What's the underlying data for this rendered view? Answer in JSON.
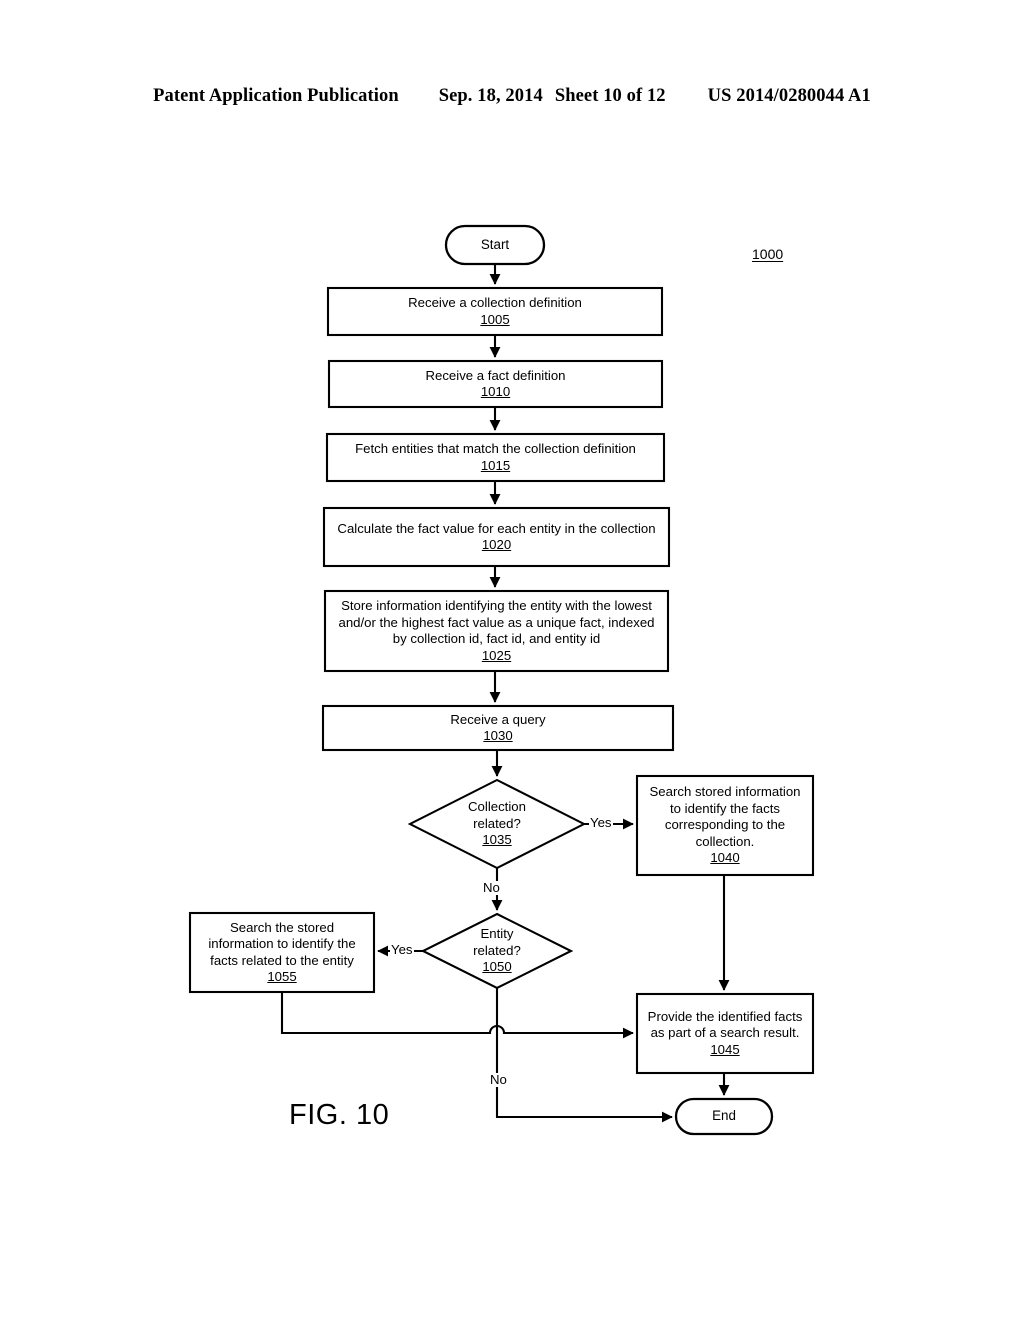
{
  "header": {
    "publication": "Patent Application Publication",
    "date": "Sep. 18, 2014",
    "sheet": "Sheet 10 of 12",
    "patent_number": "US 2014/0280044 A1"
  },
  "figure": {
    "caption": "FIG. 10",
    "reference_numeral": "1000"
  },
  "nodes": {
    "start": {
      "label": "Start",
      "shape": "terminator"
    },
    "end": {
      "label": "End",
      "shape": "terminator"
    },
    "step_1005": {
      "lines": [
        "Receive a collection definition"
      ],
      "ref": "1005",
      "shape": "process"
    },
    "step_1010": {
      "lines": [
        "Receive a fact definition"
      ],
      "ref": "1010",
      "shape": "process"
    },
    "step_1015": {
      "lines": [
        "Fetch entities that match the collection definition"
      ],
      "ref": "1015",
      "shape": "process"
    },
    "step_1020": {
      "lines": [
        "Calculate the fact value for each entity in the collection"
      ],
      "ref": "1020",
      "shape": "process"
    },
    "step_1025": {
      "lines": [
        "Store information identifying the entity with the lowest",
        "and/or the highest fact value as a unique fact, indexed",
        "by collection id, fact id, and entity id"
      ],
      "ref": "1025",
      "shape": "process"
    },
    "step_1030": {
      "lines": [
        "Receive a query"
      ],
      "ref": "1030",
      "shape": "process"
    },
    "decision_1035": {
      "lines": [
        "Collection",
        "related?"
      ],
      "ref": "1035",
      "shape": "decision"
    },
    "step_1040": {
      "lines": [
        "Search stored information",
        "to identify the facts",
        "corresponding to the",
        "collection."
      ],
      "ref": "1040",
      "shape": "process"
    },
    "step_1045": {
      "lines": [
        "Provide the identified facts",
        "as part of a search result."
      ],
      "ref": "1045",
      "shape": "process"
    },
    "decision_1050": {
      "lines": [
        "Entity",
        "related?"
      ],
      "ref": "1050",
      "shape": "decision"
    },
    "step_1055": {
      "lines": [
        "Search the stored",
        "information to identify the",
        "facts related to the entity"
      ],
      "ref": "1055",
      "shape": "process"
    }
  },
  "edge_labels": {
    "yes_1035": "Yes",
    "no_1035": "No",
    "yes_1050": "Yes",
    "no_1050": "No"
  },
  "chart_data": {
    "type": "diagram",
    "diagram_kind": "flowchart",
    "title": "FIG. 10",
    "reference_numeral": "1000",
    "edges": [
      {
        "from": "start",
        "to": "step_1005",
        "label": ""
      },
      {
        "from": "step_1005",
        "to": "step_1010",
        "label": ""
      },
      {
        "from": "step_1010",
        "to": "step_1015",
        "label": ""
      },
      {
        "from": "step_1015",
        "to": "step_1020",
        "label": ""
      },
      {
        "from": "step_1020",
        "to": "step_1025",
        "label": ""
      },
      {
        "from": "step_1025",
        "to": "step_1030",
        "label": ""
      },
      {
        "from": "step_1030",
        "to": "decision_1035",
        "label": ""
      },
      {
        "from": "decision_1035",
        "to": "step_1040",
        "label": "Yes"
      },
      {
        "from": "decision_1035",
        "to": "decision_1050",
        "label": "No"
      },
      {
        "from": "step_1040",
        "to": "step_1045",
        "label": ""
      },
      {
        "from": "decision_1050",
        "to": "step_1055",
        "label": "Yes"
      },
      {
        "from": "decision_1050",
        "to": "end",
        "label": "No"
      },
      {
        "from": "step_1055",
        "to": "step_1045",
        "label": ""
      },
      {
        "from": "step_1045",
        "to": "end",
        "label": ""
      }
    ]
  }
}
